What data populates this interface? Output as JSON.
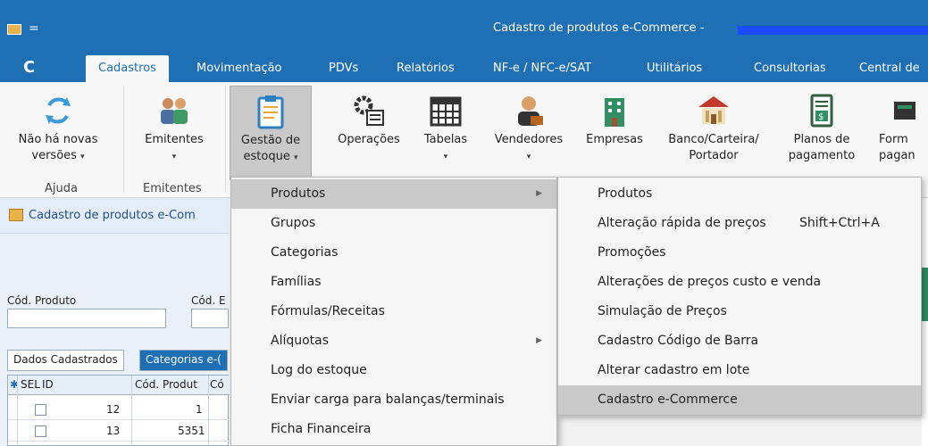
{
  "window": {
    "title": "Cadastro de produtos e-Commerce - ",
    "qa_arrow": "="
  },
  "ribbon_tabs": {
    "file": "C",
    "items": [
      "Cadastros",
      "Movimentação",
      "PDVs",
      "Relatórios",
      "NF-e / NFC-e/SAT",
      "Utilitários",
      "Consultorias",
      "Central de"
    ]
  },
  "ribbon": {
    "buttons": [
      {
        "label1": "Não há novas",
        "label2": "versões",
        "chevron": "▾",
        "icon": "refresh-icon"
      },
      {
        "label1": "Emitentes",
        "label2": "",
        "chevron": "▾",
        "icon": "people-icon"
      },
      {
        "label1": "Gestão de",
        "label2": "estoque",
        "chevron": "▾",
        "icon": "clipboard-icon"
      },
      {
        "label1": "Operações",
        "label2": "",
        "chevron": "",
        "icon": "gears-icon"
      },
      {
        "label1": "Tabelas",
        "label2": "",
        "chevron": "▾",
        "icon": "table-icon"
      },
      {
        "label1": "Vendedores",
        "label2": "",
        "chevron": "▾",
        "icon": "salesman-icon"
      },
      {
        "label1": "Empresas",
        "label2": "",
        "chevron": "",
        "icon": "building-icon"
      },
      {
        "label1": "Banco/Carteira/",
        "label2": "Portador",
        "chevron": "",
        "icon": "bank-icon"
      },
      {
        "label1": "Planos de",
        "label2": "pagamento",
        "chevron": "",
        "icon": "bill-icon"
      },
      {
        "label1": "Form",
        "label2": "pagan",
        "chevron": "",
        "icon": "card-icon"
      }
    ],
    "groups": [
      "Ajuda",
      "Emitentes"
    ]
  },
  "document": {
    "tab_title": "Cadastro de produtos e-Com",
    "fields": {
      "cod_produto": "Cód. Produto",
      "cod_b": "Cód. E"
    },
    "subtabs": [
      "Dados Cadastrados",
      "Categorias e-("
    ],
    "grid": {
      "headers": [
        "SEL",
        "ID",
        "Cód. Produt",
        "Có"
      ],
      "rows": [
        {
          "id": "12",
          "cod": "1"
        },
        {
          "id": "13",
          "cod": "5351"
        }
      ]
    }
  },
  "menu_estoque": {
    "items": [
      {
        "label": "Produtos",
        "submenu": true,
        "highlighted": true
      },
      {
        "label": "Grupos"
      },
      {
        "label": "Categorias"
      },
      {
        "label": "Famílias"
      },
      {
        "label": "Fórmulas/Receitas"
      },
      {
        "label": "Alíquotas",
        "submenu": true
      },
      {
        "label": "Log do estoque"
      },
      {
        "label": "Enviar carga para balanças/terminais"
      },
      {
        "label": "Ficha Financeira"
      }
    ]
  },
  "menu_produtos": {
    "items": [
      {
        "label": "Produtos"
      },
      {
        "label": "Alteração rápida de preços",
        "shortcut": "Shift+Ctrl+A"
      },
      {
        "label": "Promoções"
      },
      {
        "label": "Alterações de preços custo e venda"
      },
      {
        "label": "Simulação de Preços"
      },
      {
        "label": "Cadastro Código de Barra"
      },
      {
        "label": "Alterar cadastro em lote"
      },
      {
        "label": "Cadastro e-Commerce",
        "highlighted": true
      }
    ]
  },
  "colors": {
    "accent": "#1f6fb5",
    "highlight": "#c9c9c9"
  }
}
